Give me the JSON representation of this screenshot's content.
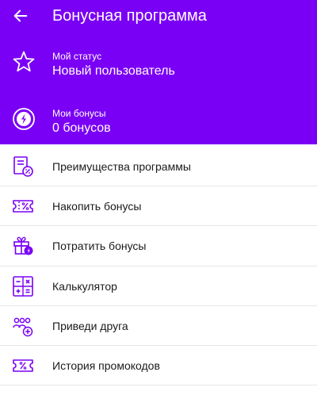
{
  "header": {
    "title": "Бонусная программа"
  },
  "status": {
    "label": "Мой статус",
    "value": "Новый пользователь",
    "icon": "star-icon"
  },
  "bonuses": {
    "label": "Мои бонусы",
    "value": "0 бонусов",
    "icon": "bonus-coin-icon"
  },
  "menu": {
    "items": [
      {
        "label": "Преимущества программы",
        "icon": "benefits-document-icon"
      },
      {
        "label": "Накопить бонусы",
        "icon": "percent-ticket-icon"
      },
      {
        "label": "Потратить бонусы",
        "icon": "gift-icon"
      },
      {
        "label": "Калькулятор",
        "icon": "calculator-icon"
      },
      {
        "label": "Приведи друга",
        "icon": "invite-friend-icon"
      },
      {
        "label": "История промокодов",
        "icon": "promo-code-icon"
      }
    ]
  },
  "colors": {
    "header_bg": "#7a00f5",
    "accent": "#7a00f5",
    "text_dark": "#1a1a1a",
    "divider": "#e6e6e6"
  }
}
